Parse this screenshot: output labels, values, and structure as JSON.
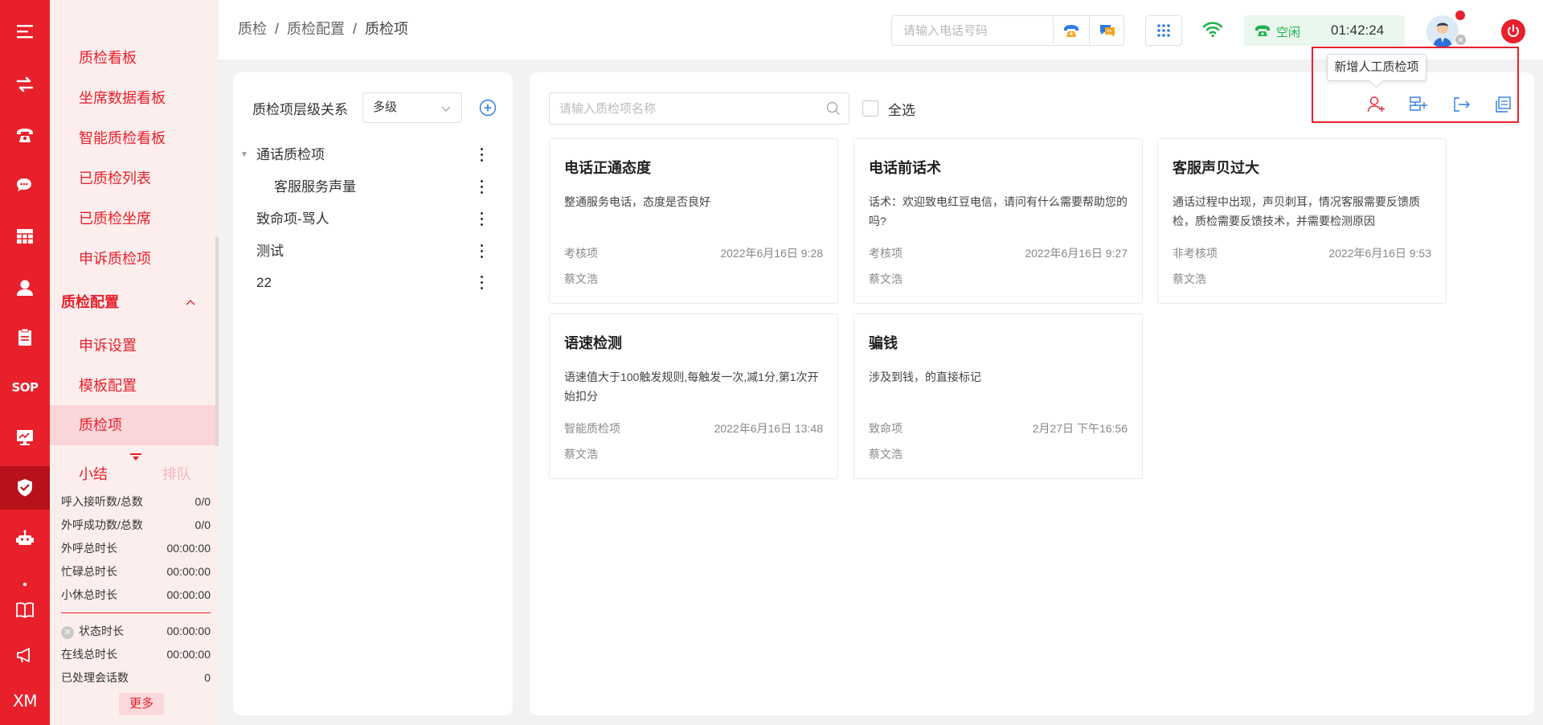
{
  "rail": {
    "items": [
      {
        "icon": "menu-icon"
      },
      {
        "icon": "transfer-arrows-icon"
      },
      {
        "icon": "phone-icon"
      },
      {
        "icon": "chat-icon"
      },
      {
        "icon": "table-grid-icon"
      },
      {
        "icon": "person-icon"
      },
      {
        "icon": "clipboard-icon"
      },
      {
        "icon": "sop-icon",
        "text": "SOP"
      },
      {
        "icon": "monitor-chart-icon"
      },
      {
        "icon": "shield-check-icon",
        "active": true
      },
      {
        "icon": "robot-icon"
      },
      {
        "icon": "dot-icon"
      },
      {
        "icon": "book-icon"
      },
      {
        "icon": "megaphone-icon"
      },
      {
        "icon": "xm-icon",
        "text": "XM"
      }
    ]
  },
  "subnav": {
    "items": [
      {
        "label": "质检看板"
      },
      {
        "label": "坐席数据看板"
      },
      {
        "label": "智能质检看板"
      },
      {
        "label": "已质检列表"
      },
      {
        "label": "已质检坐席"
      },
      {
        "label": "申诉质检项"
      }
    ],
    "group": {
      "label": "质检配置",
      "chevron": "^"
    },
    "group_items": [
      {
        "label": "申诉设置"
      },
      {
        "label": "模板配置"
      },
      {
        "label": "质检项",
        "selected": true
      }
    ],
    "stats": {
      "tab_summary": "小结",
      "tab_queue": "排队",
      "rows": [
        {
          "label": "呼入接听数/总数",
          "value": "0/0"
        },
        {
          "label": "外呼成功数/总数",
          "value": "0/0"
        },
        {
          "label": "外呼总时长",
          "value": "00:00:00"
        },
        {
          "label": "忙碌总时长",
          "value": "00:00:00"
        },
        {
          "label": "小休总时长",
          "value": "00:00:00"
        }
      ],
      "rows2": [
        {
          "label": "状态时长",
          "value": "00:00:00"
        },
        {
          "label": "在线总时长",
          "value": "00:00:00"
        },
        {
          "label": "已处理会话数",
          "value": "0"
        }
      ],
      "more": "更多"
    }
  },
  "header": {
    "breadcrumb": [
      "质检",
      "质检配置",
      "质检项"
    ],
    "breadcrumb_sep": "/",
    "phone_placeholder": "请输入电话号码",
    "status": "空闲",
    "timer": "01:42:24",
    "colors": {
      "brand": "#e8202b",
      "online": "#22b14c"
    }
  },
  "left_panel": {
    "title": "质检项层级关系",
    "select_value": "多级",
    "tree": [
      {
        "label": "通话质检项",
        "level": 0,
        "expanded": true
      },
      {
        "label": "客服服务声量",
        "level": 1
      },
      {
        "label": "致命项-骂人",
        "level": 0
      },
      {
        "label": "测试",
        "level": 0
      },
      {
        "label": "22",
        "level": 0
      }
    ]
  },
  "right_panel": {
    "search_placeholder": "请输入质检项名称",
    "select_all": "全选",
    "tooltip": "新增人工质检项",
    "actions": [
      {
        "icon": "add-person-icon"
      },
      {
        "icon": "add-server-icon"
      },
      {
        "icon": "export-icon"
      },
      {
        "icon": "copy-icon"
      }
    ],
    "cards": [
      {
        "title": "电话正通态度",
        "desc": "整通服务电话，态度是否良好",
        "type": "考核项",
        "date": "2022年6月16日 9:28",
        "author": "蔡文浩"
      },
      {
        "title": "电话前话术",
        "desc": "话术：欢迎致电红豆电信，请问有什么需要帮助您的吗?",
        "type": "考核项",
        "date": "2022年6月16日 9:27",
        "author": "蔡文浩"
      },
      {
        "title": "客服声贝过大",
        "desc": "通话过程中出现，声贝刺耳，情况客服需要反馈质检，质检需要反馈技术，并需要检测原因",
        "type": "非考核项",
        "date": "2022年6月16日 9:53",
        "author": "蔡文浩"
      },
      {
        "title": "语速检测",
        "desc": "语速值大于100触发规则,每触发一次,减1分,第1次开始扣分",
        "type": "智能质检项",
        "date": "2022年6月16日 13:48",
        "author": "蔡文浩"
      },
      {
        "title": "骗钱",
        "desc": "涉及到钱，的直接标记",
        "type": "致命项",
        "date": "2月27日 下午16:56",
        "author": "蔡文浩"
      }
    ]
  }
}
